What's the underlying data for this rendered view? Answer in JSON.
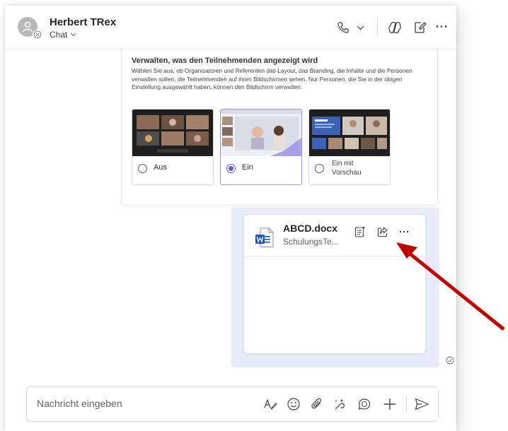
{
  "header": {
    "contact_name": "Herbert TRex",
    "subtitle": "Chat",
    "icons": [
      "call-icon",
      "chevron-down-icon",
      "copilot-icon",
      "edit-icon",
      "more-icon"
    ]
  },
  "card": {
    "heading": "Verwalten, was den Teilnehmenden angezeigt wird",
    "description": "Wählen Sie aus, ob Organisatoren und Referenten das Layout, das Branding, die Inhalte und die Personen verwalten sollen, die Teilnehmenden auf ihren Bildschirmen sehen. Nur Personen, die Sie in der obigen Einstellung ausgewählt haben, können den Bildschirm verwalten.",
    "options": [
      {
        "label": "Aus",
        "selected": false
      },
      {
        "label": "Ein",
        "selected": true
      },
      {
        "label": "Ein mit Vorschau",
        "selected": false
      }
    ]
  },
  "file_message": {
    "file_name": "ABCD.docx",
    "location": "SchulungsTe...",
    "icons": [
      "word-file-icon",
      "open-details-icon",
      "share-icon",
      "more-icon"
    ],
    "status": "seen-check-icon"
  },
  "compose": {
    "placeholder": "Nachricht eingeben",
    "icons": [
      "format-icon",
      "emoji-icon",
      "attach-icon",
      "loop-icon",
      "praise-icon",
      "plus-icon",
      "send-icon"
    ]
  },
  "colors": {
    "accent": "#5b5fc7",
    "bubble": "#e8ebfa",
    "arrow": "#c00000"
  }
}
